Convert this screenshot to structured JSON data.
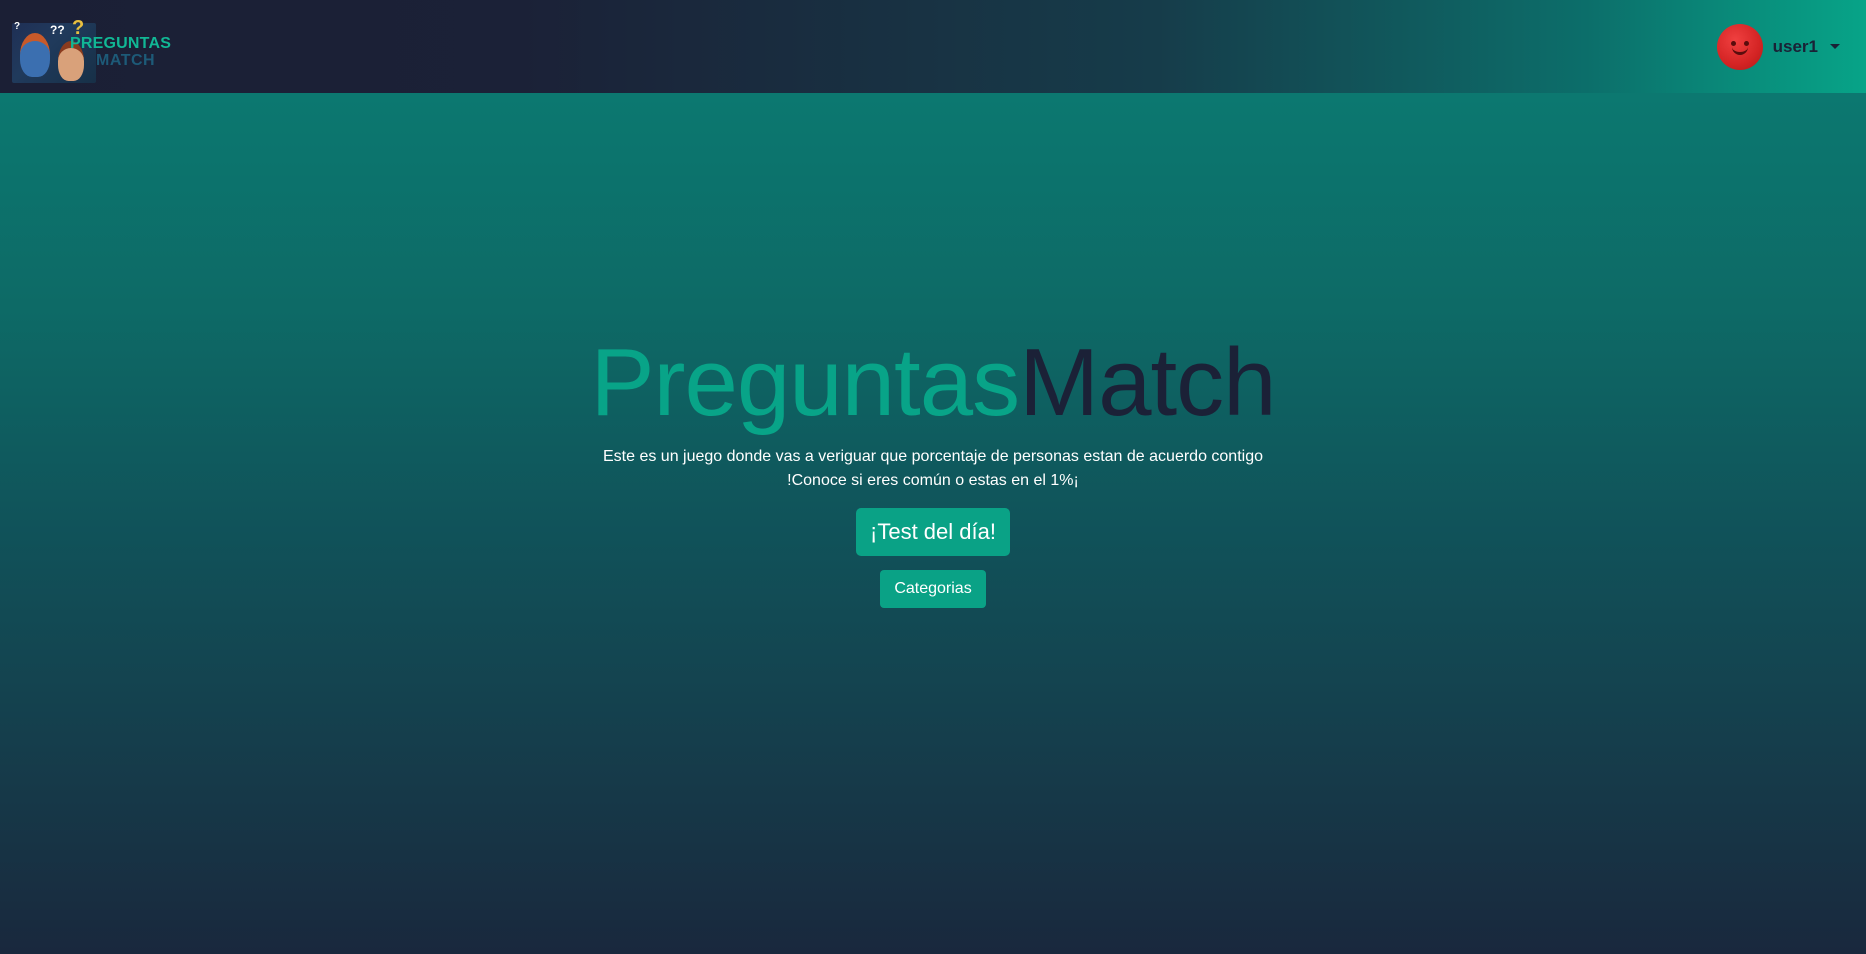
{
  "navbar": {
    "logo": {
      "line1": "PREGUNTAS",
      "line2": "MATCH"
    },
    "user": {
      "name": "user1",
      "avatar_icon": "red-smiley-avatar"
    }
  },
  "hero": {
    "title_part1": "Preguntas",
    "title_part2": "Match",
    "description_line1": "Este es un juego donde vas a veriguar que porcentaje de personas estan de acuerdo contigo",
    "description_line2": "!Conoce si eres común o estas en el 1%¡",
    "primary_button": "¡Test del día!",
    "secondary_button": "Categorias"
  },
  "colors": {
    "accent": "#0aa286",
    "dark": "#1b2137",
    "avatar": "#d42424"
  }
}
